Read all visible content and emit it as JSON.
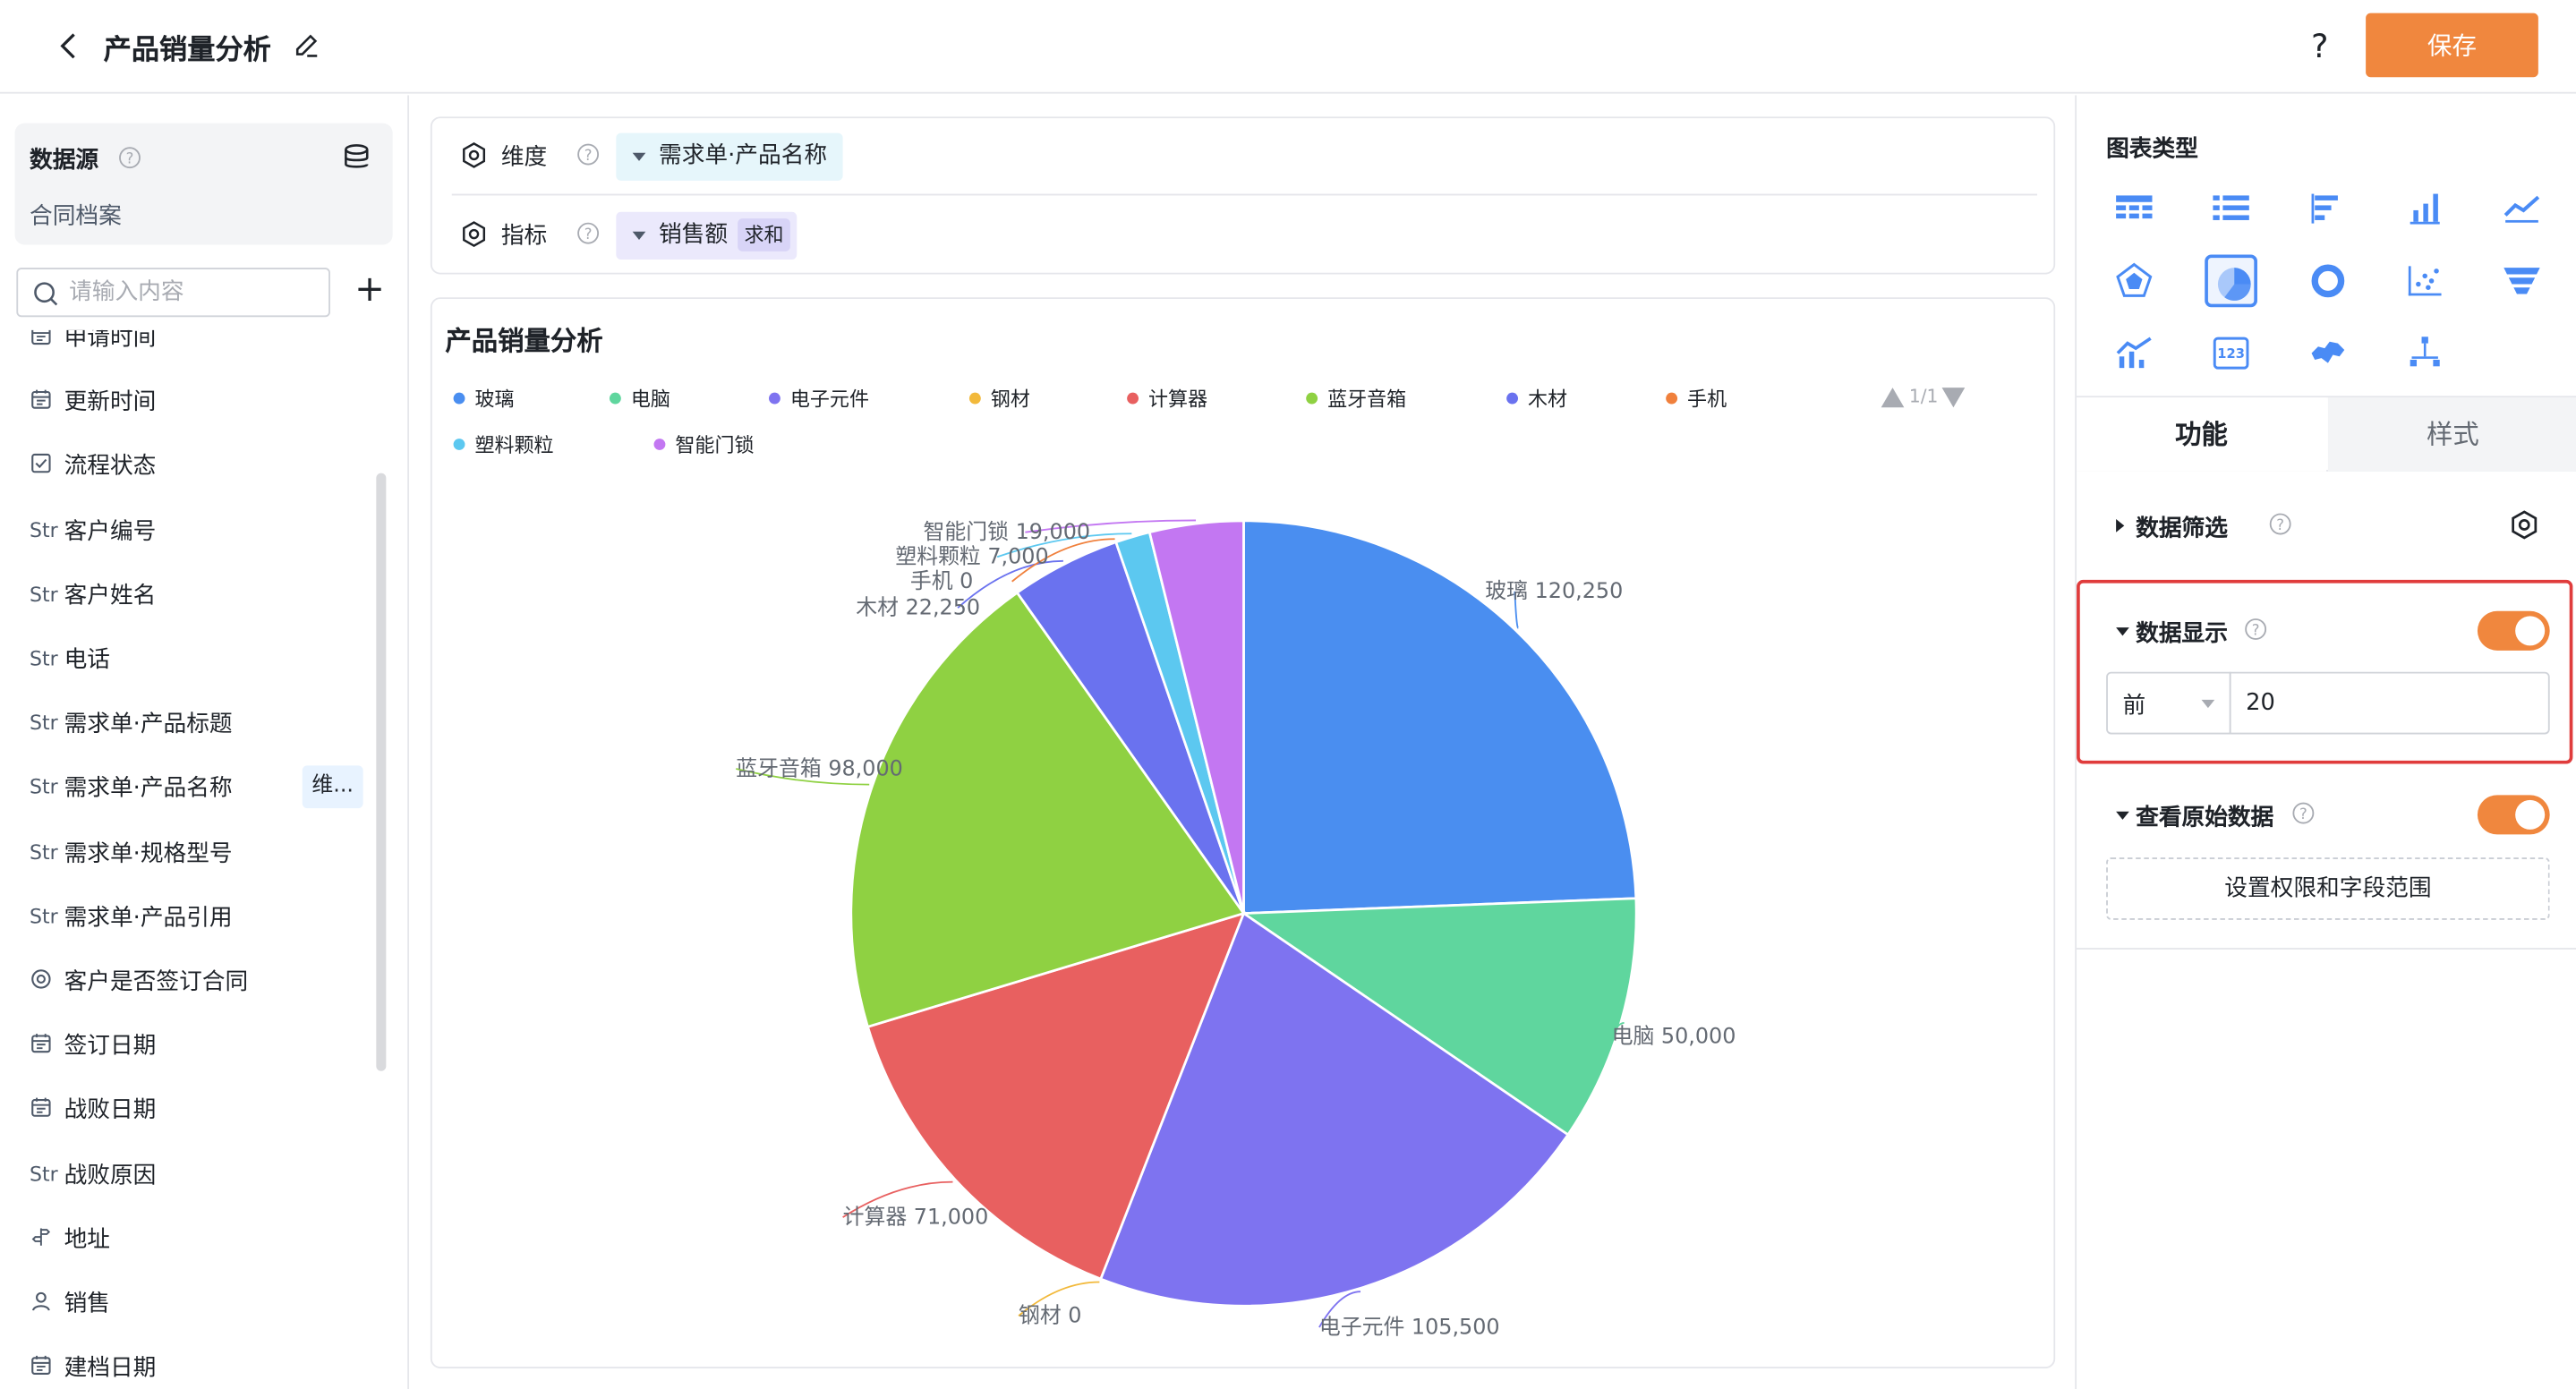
{
  "header": {
    "title": "产品销量分析",
    "help_label": "?",
    "save_label": "保存"
  },
  "datasource": {
    "title": "数据源",
    "name": "合同档案",
    "search_placeholder": "请输入内容",
    "add_label": "+",
    "fields": [
      {
        "icon": "date",
        "label": "申请时间"
      },
      {
        "icon": "date",
        "label": "更新时间"
      },
      {
        "icon": "checkbox",
        "label": "流程状态"
      },
      {
        "icon": "str",
        "label": "客户编号"
      },
      {
        "icon": "str",
        "label": "客户姓名"
      },
      {
        "icon": "str",
        "label": "电话"
      },
      {
        "icon": "str",
        "label": "需求单·产品标题"
      },
      {
        "icon": "str",
        "label": "需求单·产品名称",
        "tag": "维..."
      },
      {
        "icon": "str",
        "label": "需求单·规格型号"
      },
      {
        "icon": "str",
        "label": "需求单·产品引用"
      },
      {
        "icon": "radio",
        "label": "客户是否签订合同"
      },
      {
        "icon": "date",
        "label": "签订日期"
      },
      {
        "icon": "date",
        "label": "战败日期"
      },
      {
        "icon": "str",
        "label": "战败原因"
      },
      {
        "icon": "location",
        "label": "地址"
      },
      {
        "icon": "user",
        "label": "销售"
      },
      {
        "icon": "date",
        "label": "建档日期"
      }
    ],
    "str_label": "Str"
  },
  "query": {
    "dimension_label": "维度",
    "dimension_value": "需求单·产品名称",
    "measure_label": "指标",
    "measure_value": "销售额",
    "measure_agg": "求和"
  },
  "chart": {
    "title": "产品销量分析",
    "pager": "1/1"
  },
  "chart_data": {
    "type": "pie",
    "title": "产品销量分析",
    "slices": [
      {
        "name": "玻璃",
        "value": 120250,
        "color": "#4a8ef0",
        "label": "玻璃 120,250"
      },
      {
        "name": "电脑",
        "value": 50000,
        "color": "#5fd69e",
        "label": "电脑 50,000"
      },
      {
        "name": "电子元件",
        "value": 105500,
        "color": "#7e73f0",
        "label": "电子元件 105,500"
      },
      {
        "name": "钢材",
        "value": 0,
        "color": "#f2b93b",
        "label": "钢材 0"
      },
      {
        "name": "计算器",
        "value": 71000,
        "color": "#e86060",
        "label": "计算器 71,000"
      },
      {
        "name": "蓝牙音箱",
        "value": 98000,
        "color": "#8fd142",
        "label": "蓝牙音箱 98,000"
      },
      {
        "name": "木材",
        "value": 22250,
        "color": "#6a72ef",
        "label": "木材 22,250"
      },
      {
        "name": "手机",
        "value": 0,
        "color": "#f0803c",
        "label": "手机 0"
      },
      {
        "name": "塑料颗粒",
        "value": 7000,
        "color": "#5cc8f0",
        "label": "塑料颗粒 7,000"
      },
      {
        "name": "智能门锁",
        "value": 19000,
        "color": "#c377f2",
        "label": "智能门锁 19,000"
      }
    ],
    "legend_position": "top-left"
  },
  "right": {
    "chart_type_title": "图表类型",
    "chart_types": [
      "table",
      "list",
      "bar-horizontal",
      "bar-vertical",
      "line",
      "radar",
      "pie",
      "donut",
      "scatter",
      "funnel",
      "combo",
      "number-card",
      "map",
      "tree"
    ],
    "active_chart_type": "pie",
    "tab_function": "功能",
    "tab_style": "样式",
    "data_filter_label": "数据筛选",
    "data_display_label": "数据显示",
    "data_display_on": true,
    "top_select": "前",
    "top_value": "20",
    "raw_data_label": "查看原始数据",
    "raw_data_on": true,
    "permission_button": "设置权限和字段范围",
    "colors": {
      "accent": "#f0873e",
      "highlight": "#e03c3c"
    }
  }
}
